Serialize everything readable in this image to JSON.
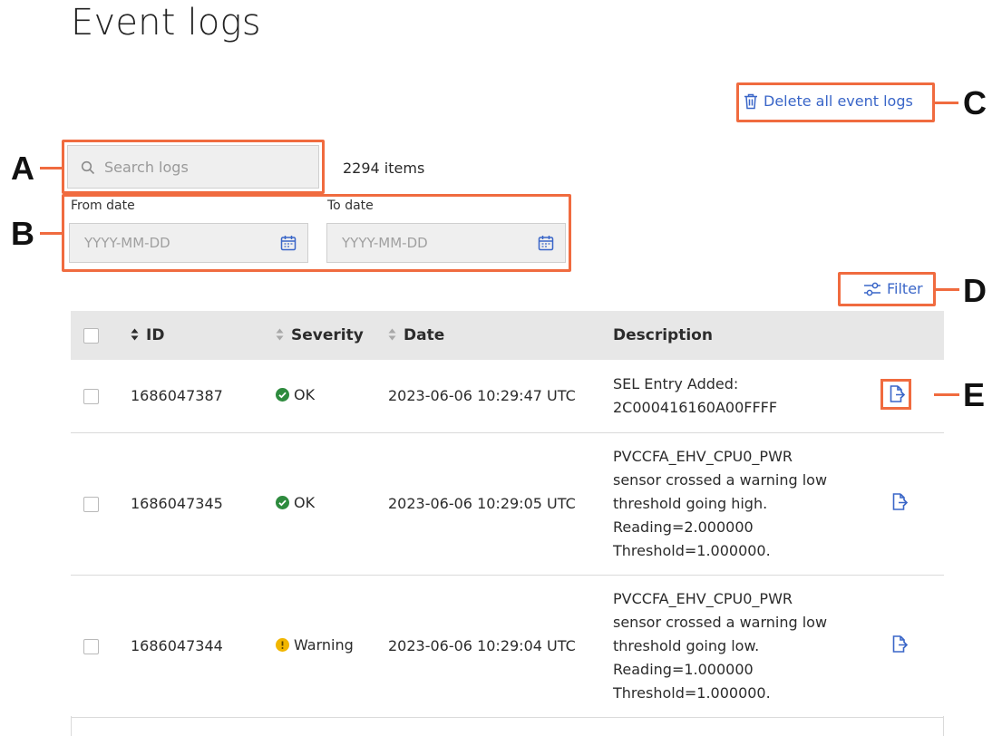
{
  "page": {
    "title": "Event logs"
  },
  "callouts": {
    "a": "A",
    "b": "B",
    "c": "C",
    "d": "D",
    "e": "E"
  },
  "actions": {
    "delete_all_label": "Delete all event logs",
    "filter_label": "Filter"
  },
  "search": {
    "placeholder": "Search logs",
    "value": "",
    "items_count": "2294 items"
  },
  "dates": {
    "from_label": "From date",
    "from_placeholder": "YYYY-MM-DD",
    "to_label": "To date",
    "to_placeholder": "YYYY-MM-DD"
  },
  "table": {
    "headers": {
      "id": "ID",
      "severity": "Severity",
      "date": "Date",
      "description": "Description"
    },
    "rows": [
      {
        "id": "1686047387",
        "severity": "OK",
        "severity_type": "ok",
        "date": "2023-06-06 10:29:47 UTC",
        "description": [
          "SEL Entry Added:",
          "2C000416160A00FFFF"
        ]
      },
      {
        "id": "1686047345",
        "severity": "OK",
        "severity_type": "ok",
        "date": "2023-06-06 10:29:05 UTC",
        "description": [
          "PVCCFA_EHV_CPU0_PWR",
          "sensor crossed a warning low",
          "threshold going high.",
          "Reading=2.000000",
          "Threshold=1.000000."
        ]
      },
      {
        "id": "1686047344",
        "severity": "Warning",
        "severity_type": "warning",
        "date": "2023-06-06 10:29:04 UTC",
        "description": [
          "PVCCFA_EHV_CPU0_PWR",
          "sensor crossed a warning low",
          "threshold going low.",
          "Reading=1.000000",
          "Threshold=1.000000."
        ]
      }
    ]
  },
  "colors": {
    "accent": "#3a66c8",
    "callout": "#f06b3f",
    "ok": "#2e8b3e",
    "warning": "#f1b600"
  }
}
